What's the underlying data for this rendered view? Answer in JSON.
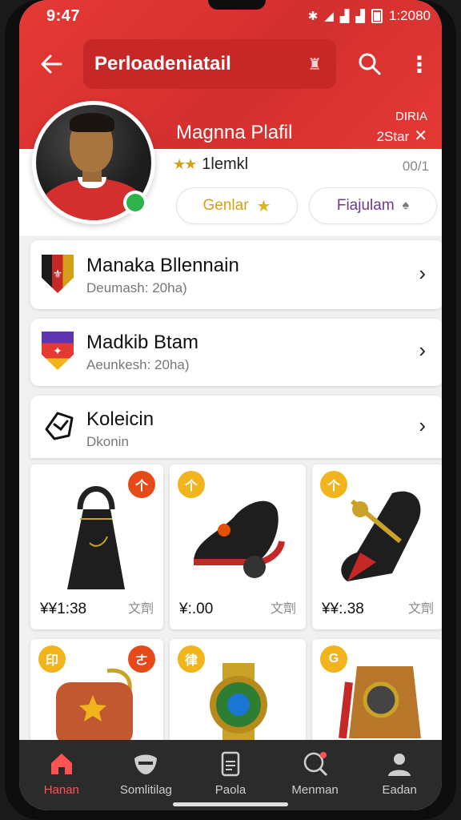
{
  "status_bar": {
    "time": "9:47",
    "battery_text": "1:2080"
  },
  "app_bar": {
    "title": "Perloadeniatail"
  },
  "profile": {
    "name": "Magnna Plafil",
    "rank_top": "DIRIA",
    "rank_bottom": "2Star",
    "stars_label": "1lemkl",
    "count": "00/1",
    "btn_gold": "Genlar",
    "btn_purple": "Fiajulam"
  },
  "cards": [
    {
      "title": "Manaka Bllennain",
      "subtitle": "Deumash: 20ha)"
    },
    {
      "title": "Madkib Btam",
      "subtitle": "Aeunkesh: 20ha)"
    },
    {
      "title": "Koleicin",
      "subtitle": "Dkonin"
    }
  ],
  "collection": [
    {
      "price": "¥¥1:38",
      "meta": "文劑",
      "badge_symbol": "个",
      "badge_color": "#e64a19"
    },
    {
      "price": "¥:.00",
      "meta": "文劑",
      "badge_symbol": "个",
      "badge_color": "#f2b41c"
    },
    {
      "price": "¥¥:.38",
      "meta": "文劑",
      "badge_symbol": "个",
      "badge_color": "#f2b41c"
    },
    {
      "price": "",
      "meta": "",
      "badge_symbol": "印",
      "badge_color": "#f2b41c"
    },
    {
      "price": "",
      "meta": "",
      "badge_symbol": "律",
      "badge_color": "#f2b41c"
    },
    {
      "price": "",
      "meta": "",
      "badge_symbol": "G",
      "badge_color": "#f2b41c"
    }
  ],
  "bottom_nav": [
    {
      "label": "Hanan",
      "icon": "home-icon",
      "active": true
    },
    {
      "label": "Somlitilag",
      "icon": "mask-icon",
      "active": false
    },
    {
      "label": "Paola",
      "icon": "document-icon",
      "active": false
    },
    {
      "label": "Menman",
      "icon": "search-icon",
      "active": false
    },
    {
      "label": "Eadan",
      "icon": "profile-icon",
      "active": false
    }
  ],
  "colors": {
    "brand_red": "#e53935",
    "gold": "#d4a017",
    "nav_bg": "#2b2b2b",
    "active": "#ff5252"
  }
}
